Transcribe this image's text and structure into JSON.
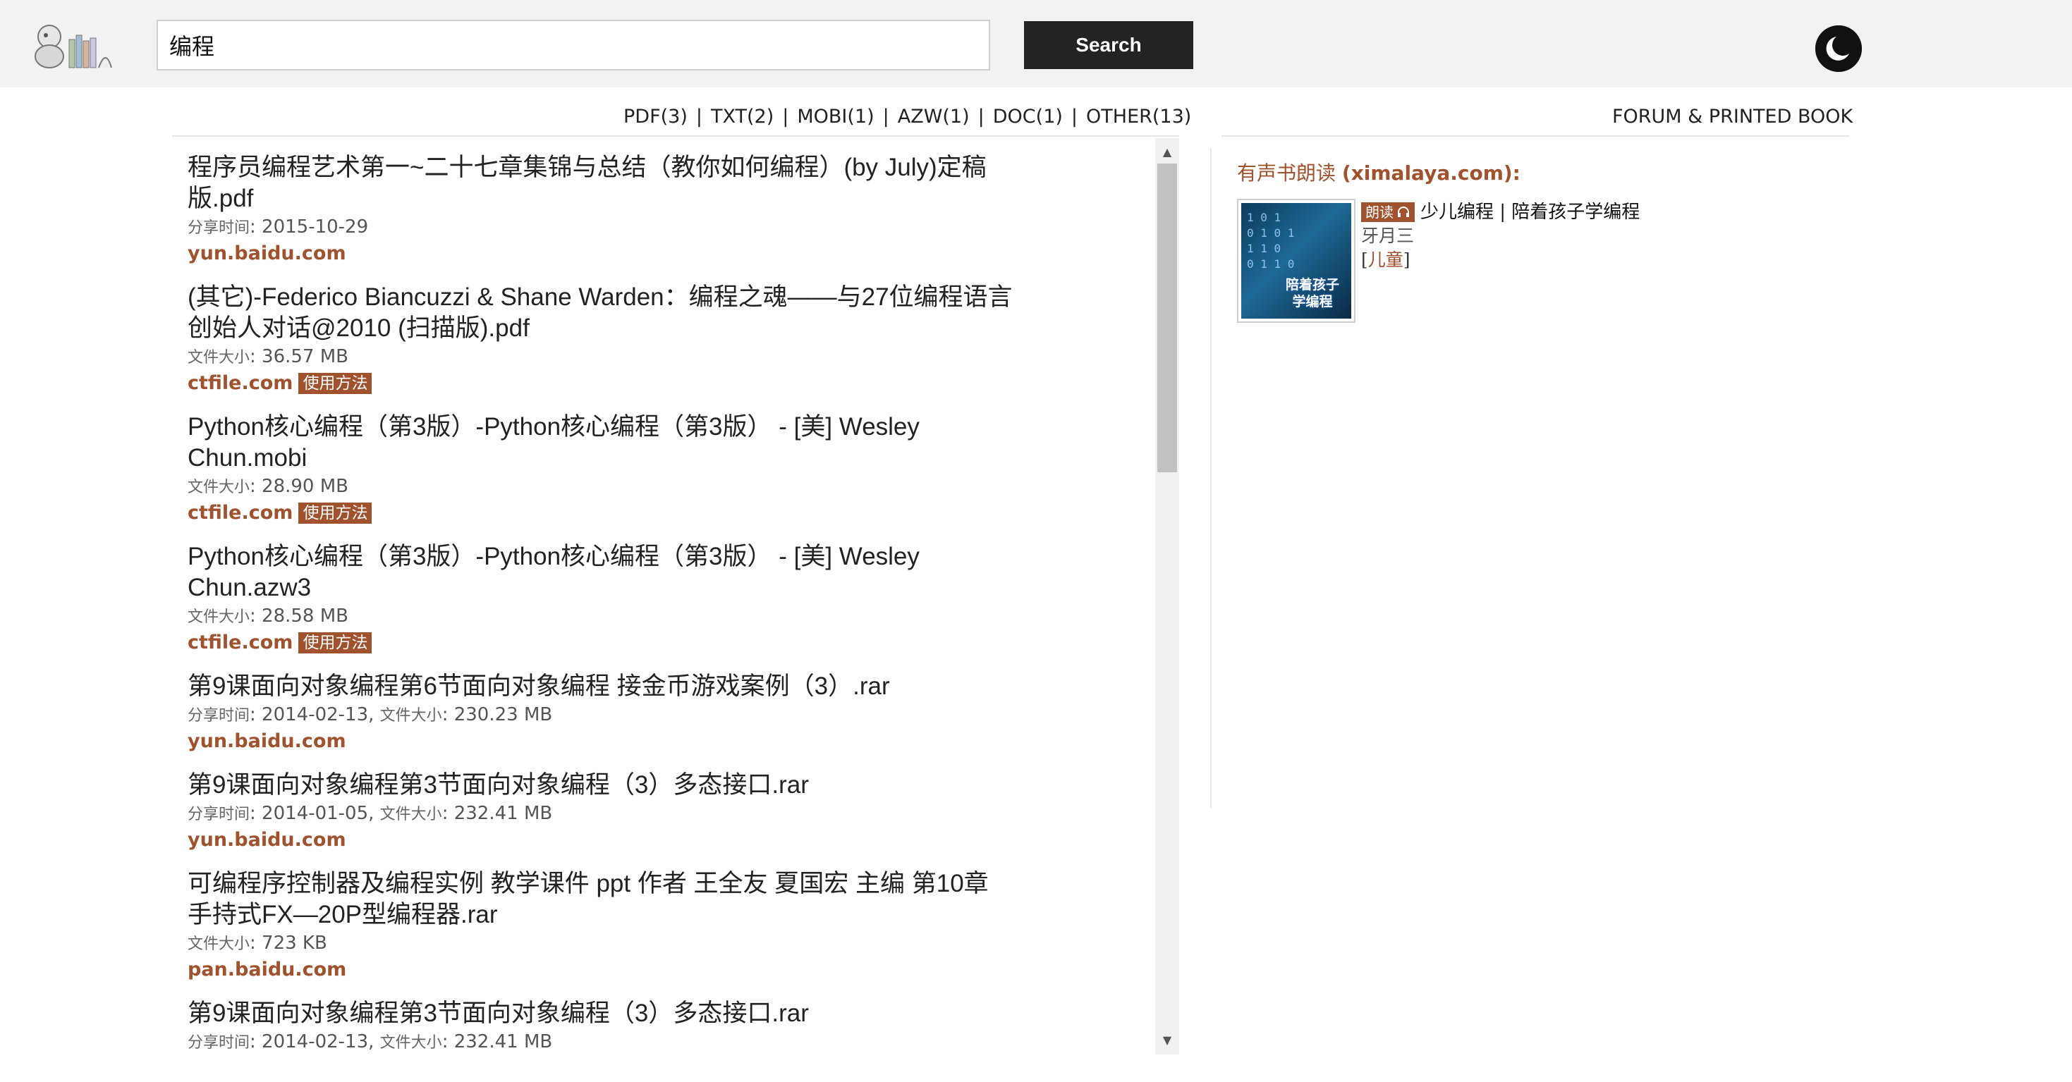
{
  "search": {
    "query": "编程",
    "button_label": "Search"
  },
  "icons": {
    "logo": "books-logo-icon",
    "theme": "moon-icon",
    "listen": "headphones-icon",
    "scroll_up": "triangle-up-icon",
    "scroll_down": "triangle-down-icon"
  },
  "filters": [
    {
      "label": "PDF(3)"
    },
    {
      "label": "TXT(2)"
    },
    {
      "label": "MOBI(1)"
    },
    {
      "label": "AZW(1)"
    },
    {
      "label": "DOC(1)"
    },
    {
      "label": "OTHER(13)"
    }
  ],
  "forum_link": "FORUM & PRINTED BOOK",
  "results": [
    {
      "title": "程序员编程艺术第一~二十七章集锦与总结（教你如何编程）(by July)定稿版.pdf",
      "meta_key": "分享时间",
      "meta_value": ": 2015-10-29",
      "source": "yun.baidu.com",
      "badge": ""
    },
    {
      "title": "(其它)-Federico Biancuzzi & Shane Warden：编程之魂——与27位编程语言创始人对话@2010 (扫描版).pdf",
      "meta_key": "文件大小",
      "meta_value": ": 36.57 MB",
      "source": "ctfile.com",
      "badge": "使用方法"
    },
    {
      "title": "Python核心编程（第3版）-Python核心编程（第3版） - [美] Wesley Chun.mobi",
      "meta_key": "文件大小",
      "meta_value": ": 28.90 MB",
      "source": "ctfile.com",
      "badge": "使用方法"
    },
    {
      "title": "Python核心编程（第3版）-Python核心编程（第3版） - [美] Wesley Chun.azw3",
      "meta_key": "文件大小",
      "meta_value": ": 28.58 MB",
      "source": "ctfile.com",
      "badge": "使用方法"
    },
    {
      "title": "第9课面向对象编程第6节面向对象编程 接金币游戏案例（3）.rar",
      "meta_key": "分享时间",
      "meta_value": ": 2014-02-13,",
      "meta_key2": "文件大小",
      "meta_value2": ": 230.23 MB",
      "source": "yun.baidu.com",
      "badge": ""
    },
    {
      "title": "第9课面向对象编程第3节面向对象编程（3）多态接口.rar",
      "meta_key": "分享时间",
      "meta_value": ": 2014-01-05,",
      "meta_key2": "文件大小",
      "meta_value2": ": 232.41 MB",
      "source": "yun.baidu.com",
      "badge": ""
    },
    {
      "title": "可编程序控制器及编程实例 教学课件 ppt 作者 王全友 夏国宏 主编 第10章 手持式FX—20P型编程器.rar",
      "meta_key": "文件大小",
      "meta_value": ": 723 KB",
      "source": "pan.baidu.com",
      "badge": ""
    },
    {
      "title": "第9课面向对象编程第3节面向对象编程（3）多态接口.rar",
      "meta_key": "分享时间",
      "meta_value": ": 2014-02-13,",
      "meta_key2": "文件大小",
      "meta_value2": ": 232.41 MB",
      "source": "",
      "badge": ""
    }
  ],
  "audio": {
    "heading_prefix": "有声书朗读",
    "heading_site": "(ximalaya.com):",
    "badge": "朗读",
    "title": "少儿编程 | 陪着孩子学编程",
    "author": "牙月三",
    "tag_open": "[",
    "tag": "儿童",
    "tag_close": "]",
    "cover_text": "陪着孩子学编程"
  },
  "colors": {
    "accent": "#a0522d",
    "header_bg": "#f2f2f2",
    "button_bg": "#232323"
  }
}
